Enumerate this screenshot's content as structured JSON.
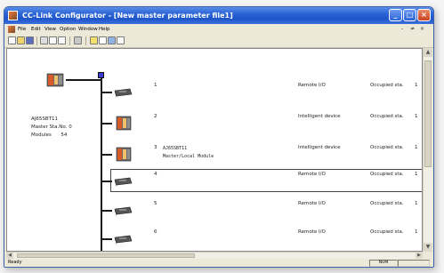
{
  "window": {
    "title": "CC-Link Configurator - [New master parameter file1]",
    "buttons": {
      "minimize": "_",
      "maximize": "□",
      "close": "×"
    }
  },
  "menu": {
    "items": [
      "File",
      "Edit",
      "View",
      "Option",
      "Window",
      "Help"
    ],
    "mdi_controls": [
      "-",
      "≠",
      "×"
    ]
  },
  "toolbar": {
    "icons": [
      "new-icon",
      "open-icon",
      "save-icon",
      "cut-icon",
      "copy-icon",
      "paste-icon",
      "print-icon",
      "help-icon",
      "question-icon",
      "find-icon",
      "properties-icon"
    ]
  },
  "master": {
    "model": "AJ65SBT11",
    "station_label": "Master Sta.No.",
    "station_no": "0",
    "modules_label": "Modules",
    "modules": "54"
  },
  "stations": [
    {
      "no": "1",
      "model": "",
      "model_sub": "",
      "type": "Remote I/O",
      "occupied_label": "Occupied sta.",
      "occupied": "1",
      "icon": "remote-io",
      "selected": false
    },
    {
      "no": "2",
      "model": "",
      "model_sub": "",
      "type": "Intelligent device",
      "occupied_label": "Occupied sta.",
      "occupied": "1",
      "icon": "intelligent",
      "selected": false
    },
    {
      "no": "3",
      "model": "AJ65SBT11",
      "model_sub": "Master/Local Module",
      "type": "Intelligent device",
      "occupied_label": "Occupied sta.",
      "occupied": "1",
      "icon": "intelligent",
      "selected": false
    },
    {
      "no": "4",
      "model": "",
      "model_sub": "",
      "type": "Remote I/O",
      "occupied_label": "Occupied sta.",
      "occupied": "1",
      "icon": "remote-io",
      "selected": true
    },
    {
      "no": "5",
      "model": "",
      "model_sub": "",
      "type": "Remote I/O",
      "occupied_label": "Occupied sta.",
      "occupied": "1",
      "icon": "remote-io",
      "selected": false
    },
    {
      "no": "6",
      "model": "",
      "model_sub": "",
      "type": "Remote I/O",
      "occupied_label": "Occupied sta.",
      "occupied": "1",
      "icon": "remote-io",
      "selected": false
    }
  ],
  "status": {
    "text": "Ready",
    "pane": "NUM"
  }
}
